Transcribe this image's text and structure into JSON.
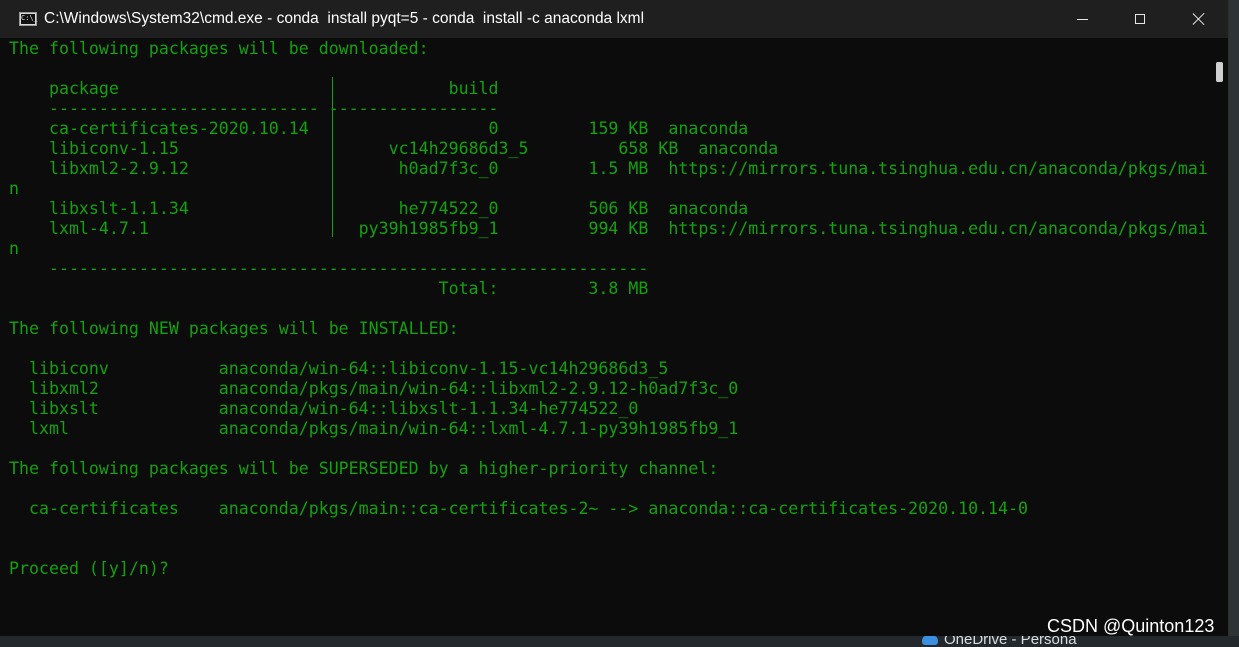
{
  "window": {
    "title": "C:\\Windows\\System32\\cmd.exe - conda  install pyqt=5 - conda  install -c anaconda lxml"
  },
  "console": {
    "lines": [
      "The following packages will be downloaded:",
      "",
      "    package                    |            build",
      "    ---------------------------|-----------------",
      "    ca-certificates-2020.10.14 |                0         159 KB  anaconda",
      "    libiconv-1.15              |      vc14h29686d3_5         658 KB  anaconda",
      "    libxml2-2.9.12             |       h0ad7f3c_0         1.5 MB  https://mirrors.tuna.tsinghua.edu.cn/anaconda/pkgs/mai",
      "n",
      "    libxslt-1.1.34             |       he774522_0         506 KB  anaconda",
      "    lxml-4.7.1                 |   py39h1985fb9_1         994 KB  https://mirrors.tuna.tsinghua.edu.cn/anaconda/pkgs/mai",
      "n",
      "    ------------------------------------------------------------",
      "                                           Total:         3.8 MB",
      "",
      "The following NEW packages will be INSTALLED:",
      "",
      "  libiconv           anaconda/win-64::libiconv-1.15-vc14h29686d3_5",
      "  libxml2            anaconda/pkgs/main/win-64::libxml2-2.9.12-h0ad7f3c_0",
      "  libxslt            anaconda/win-64::libxslt-1.1.34-he774522_0",
      "  lxml               anaconda/pkgs/main/win-64::lxml-4.7.1-py39h1985fb9_1",
      "",
      "The following packages will be SUPERSEDED by a higher-priority channel:",
      "",
      "  ca-certificates    anaconda/pkgs/main::ca-certificates-2~ --> anaconda::ca-certificates-2020.10.14-0",
      "",
      "",
      "Proceed ([y]/n)?"
    ]
  },
  "taskbar": {
    "onedrive_label": "OneDrive - Persona"
  },
  "watermark": "CSDN @Quinton123",
  "colors": {
    "console_bg": "#0c0c0c",
    "console_text": "#13a10e",
    "titlebar_bg": "#1f1f1f"
  }
}
